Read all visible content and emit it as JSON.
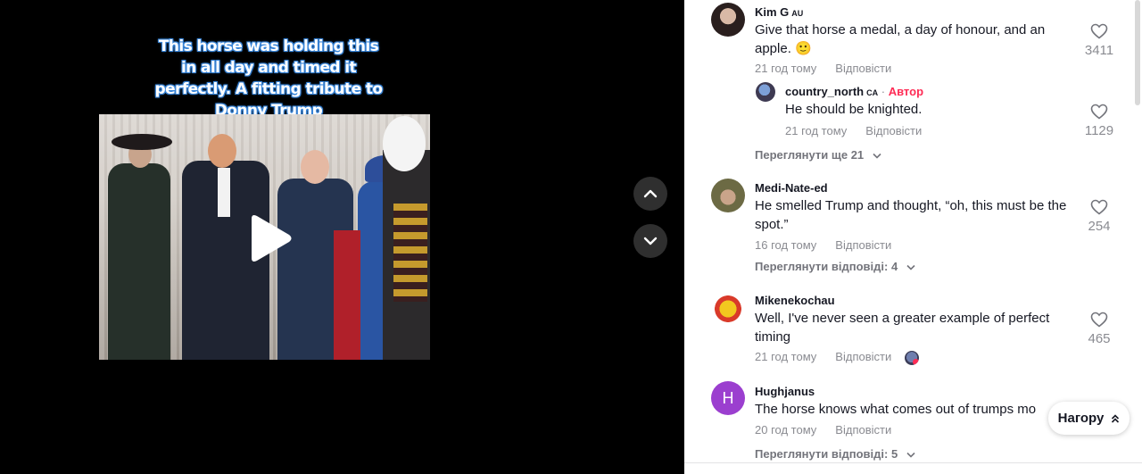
{
  "video": {
    "caption": "This horse was holding this in all day and timed it perfectly. A fitting tribute to Donny Trump"
  },
  "comments": [
    {
      "username": "Kim G",
      "country": "AU",
      "text": "Give that horse a medal, a day of honour, and an apple. 🙂",
      "time": "21 год тому",
      "reply_label": "Відповісти",
      "likes": "3411",
      "replies": [
        {
          "username": "country_north",
          "country": "CA",
          "badge_sep": "·",
          "badge": "Автор",
          "text": "He should be knighted.",
          "time": "21 год тому",
          "reply_label": "Відповісти",
          "likes": "1129"
        }
      ],
      "more_label": "Переглянути ще 21"
    },
    {
      "username": "Medi-Nate-ed",
      "text": "He smelled Trump and thought, “oh, this must be the spot.”",
      "time": "16 год тому",
      "reply_label": "Відповісти",
      "likes": "254",
      "more_label": "Переглянути відповіді: 4"
    },
    {
      "username": "Mikenekochau",
      "text": "Well, I've never seen a greater example of perfect timing",
      "time": "21 год тому",
      "reply_label": "Відповісти",
      "likes": "465"
    },
    {
      "username": "Hughjanus",
      "avatar_letter": "H",
      "avatar_color": "#9b3fcf",
      "text": "The horse knows what comes out of trumps mo",
      "time": "20 год тому",
      "reply_label": "Відповісти",
      "more_label": "Переглянути відповіді: 5"
    }
  ],
  "back_to_top": "Нагору",
  "colors": {
    "accent": "#fe2c55",
    "muted": "#8a8b91",
    "text": "#161823"
  }
}
